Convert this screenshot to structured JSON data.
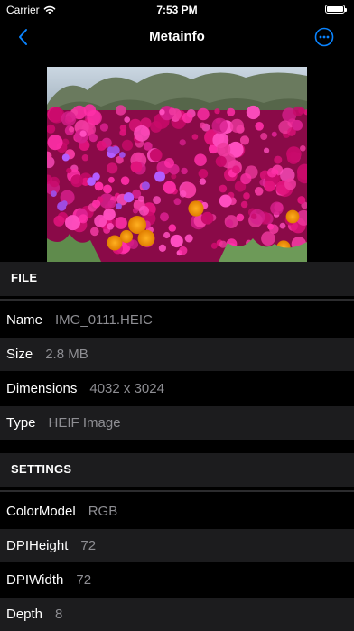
{
  "status": {
    "carrier": "Carrier",
    "time": "7:53 PM",
    "battery_level": 1.0
  },
  "nav": {
    "title": "Metainfo",
    "back_icon": "chevron-left-icon",
    "more_icon": "ellipsis-circle-icon",
    "accent": "#0a84ff"
  },
  "sections": [
    {
      "header": "FILE",
      "rows": [
        {
          "key": "Name",
          "value": "IMG_0111.HEIC"
        },
        {
          "key": "Size",
          "value": "2.8 MB"
        },
        {
          "key": "Dimensions",
          "value": "4032 x 3024"
        },
        {
          "key": "Type",
          "value": "HEIF Image"
        }
      ]
    },
    {
      "header": "SETTINGS",
      "rows": [
        {
          "key": "ColorModel",
          "value": "RGB"
        },
        {
          "key": "DPIHeight",
          "value": "72"
        },
        {
          "key": "DPIWidth",
          "value": "72"
        },
        {
          "key": "Depth",
          "value": "8"
        }
      ]
    }
  ]
}
